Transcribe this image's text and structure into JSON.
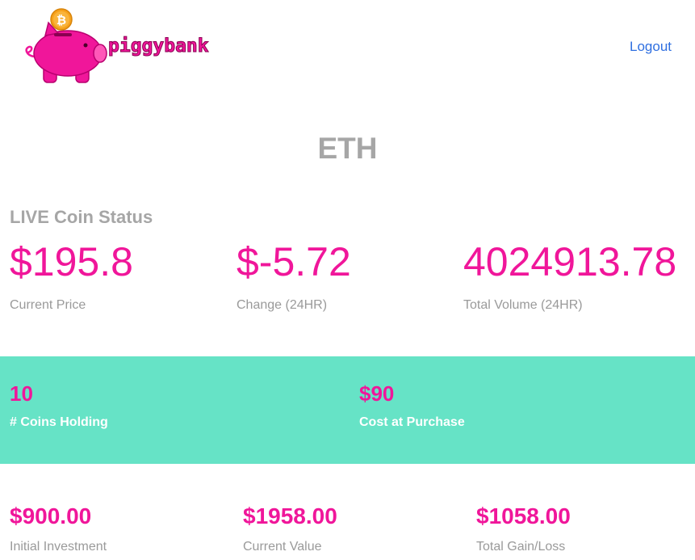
{
  "brand": {
    "name": "piggybank",
    "coin_symbol": "₿",
    "logo_color": "#f0169a"
  },
  "nav": {
    "logout_label": "Logout"
  },
  "coin": {
    "symbol": "ETH"
  },
  "live_status": {
    "heading": "LIVE Coin Status",
    "stats": [
      {
        "value": "$195.8",
        "label": "Current Price"
      },
      {
        "value": "$-5.72",
        "label": "Change (24HR)"
      },
      {
        "value": "4024913.78",
        "label": "Total Volume (24HR)"
      }
    ]
  },
  "holdings": {
    "band_color": "#66e3c6",
    "items": [
      {
        "value": "10",
        "label": "# Coins Holding"
      },
      {
        "value": "$90",
        "label": "Cost at Purchase"
      }
    ]
  },
  "summary": {
    "items": [
      {
        "value": "$900.00",
        "label": "Initial Investment"
      },
      {
        "value": "$1958.00",
        "label": "Current Value"
      },
      {
        "value": "$1058.00",
        "label": "Total Gain/Loss"
      }
    ]
  },
  "colors": {
    "accent": "#f0169a",
    "muted": "#a6a6a6",
    "link": "#2f6fe0"
  }
}
